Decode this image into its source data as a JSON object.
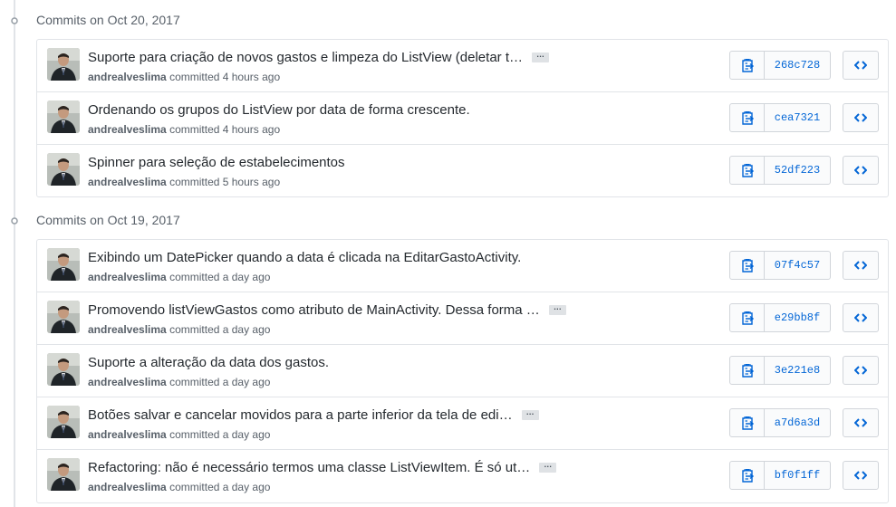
{
  "groups": [
    {
      "header": "Commits on Oct 20, 2017",
      "commits": [
        {
          "title": "Suporte para criação de novos gastos e limpeza do ListView (deletar t…",
          "truncated": true,
          "author": "andrealveslima",
          "time": "committed 4 hours ago",
          "sha": "268c728"
        },
        {
          "title": "Ordenando os grupos do ListView por data de forma crescente.",
          "truncated": false,
          "author": "andrealveslima",
          "time": "committed 4 hours ago",
          "sha": "cea7321"
        },
        {
          "title": "Spinner para seleção de estabelecimentos",
          "truncated": false,
          "author": "andrealveslima",
          "time": "committed 5 hours ago",
          "sha": "52df223"
        }
      ]
    },
    {
      "header": "Commits on Oct 19, 2017",
      "commits": [
        {
          "title": "Exibindo um DatePicker quando a data é clicada na EditarGastoActivity.",
          "truncated": false,
          "author": "andrealveslima",
          "time": "committed a day ago",
          "sha": "07f4c57"
        },
        {
          "title": "Promovendo listViewGastos como atributo de MainActivity. Dessa forma …",
          "truncated": true,
          "author": "andrealveslima",
          "time": "committed a day ago",
          "sha": "e29bb8f"
        },
        {
          "title": "Suporte a alteração da data dos gastos.",
          "truncated": false,
          "author": "andrealveslima",
          "time": "committed a day ago",
          "sha": "3e221e8"
        },
        {
          "title": "Botões salvar e cancelar movidos para a parte inferior da tela de edi…",
          "truncated": true,
          "author": "andrealveslima",
          "time": "committed a day ago",
          "sha": "a7d6a3d"
        },
        {
          "title": "Refactoring: não é necessário termos uma classe ListViewItem. É só ut…",
          "truncated": true,
          "author": "andrealveslima",
          "time": "committed a day ago",
          "sha": "bf0f1ff"
        }
      ]
    }
  ],
  "ellipsis_label": "…",
  "icons": {
    "commit_node": "git-commit-icon",
    "copy": "clippy-icon",
    "browse": "code-icon",
    "avatar": "user-avatar"
  },
  "colors": {
    "link_blue": "#0366d6",
    "border": "#e1e4e8",
    "muted_text": "#586069",
    "button_bg": "#fafbfc"
  }
}
